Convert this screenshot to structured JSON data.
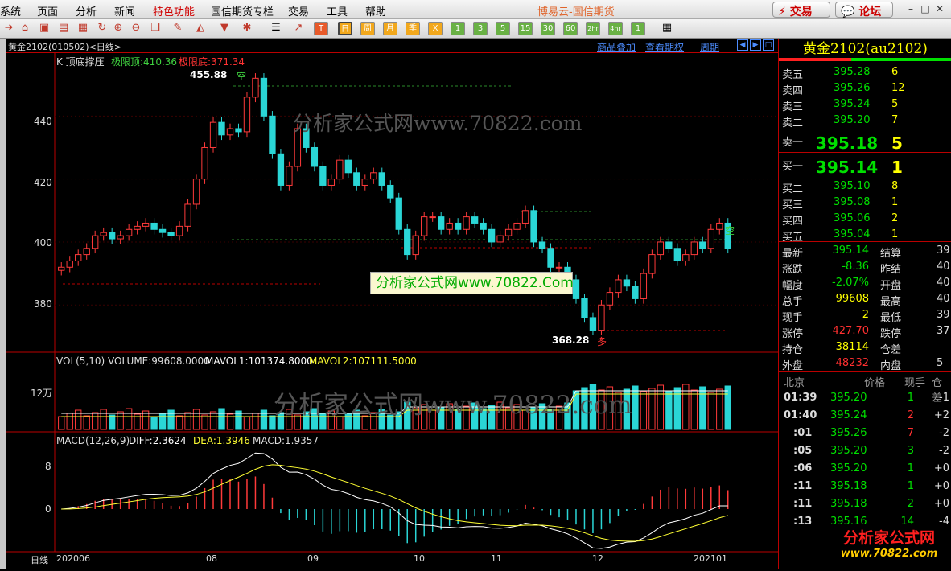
{
  "menu": {
    "items": [
      "系统",
      "页面",
      "分析",
      "新闻",
      "特色功能",
      "国信期货专栏",
      "交易",
      "工具",
      "帮助"
    ],
    "app_title": "博易云-国信期货",
    "trade_button": "交易",
    "forum_button": "论坛"
  },
  "toolbar": {
    "periods": [
      "日",
      "周",
      "月",
      "季",
      "X",
      "1",
      "3",
      "5",
      "15",
      "30",
      "60",
      "2hr",
      "4hr",
      "1"
    ]
  },
  "chart_header": {
    "code": "黄金2102(010502)<日线>",
    "links": [
      "商品叠加",
      "查看期权",
      "周期"
    ]
  },
  "kline": {
    "indicator": "K  顶底撑压",
    "top_label": "极限顶:410.36",
    "bottom_label": "极限底:371.34",
    "high_label": "455.88",
    "low_label": "368.28",
    "short_mark": "空",
    "long_mark": "多",
    "yticks": [
      "440",
      "420",
      "400",
      "380"
    ]
  },
  "vol": {
    "title": "VOL(5,10)",
    "volume": "VOLUME:99608.0000",
    "mavol1": "MAVOL1:101374.8000",
    "mavol2": "MAVOL2:107111.5000",
    "ytick": "12万"
  },
  "macd": {
    "title": "MACD(12,26,9)",
    "diff": "DIFF:2.3624",
    "dea": "DEA:1.3946",
    "macd": "MACD:1.9357",
    "yticks": [
      "8",
      "0"
    ]
  },
  "xaxis": {
    "period_label": "日线",
    "labels": [
      "202006",
      "08",
      "09",
      "10",
      "11",
      "12",
      "202101"
    ]
  },
  "watermarks": {
    "main": "分析家公式网www.70822.com",
    "vol": "分析家公式网www.70822.com",
    "box": "分析家公式网www.70822.Com",
    "logo_line1": "分析家公式网",
    "logo_line2": "www.70822.com"
  },
  "quote": {
    "title": "黄金2102(au2102)",
    "asks": [
      {
        "label": "卖五",
        "price": "395.28",
        "vol": "6"
      },
      {
        "label": "卖四",
        "price": "395.26",
        "vol": "12"
      },
      {
        "label": "卖三",
        "price": "395.24",
        "vol": "5"
      },
      {
        "label": "卖二",
        "price": "395.20",
        "vol": "7"
      },
      {
        "label": "卖一",
        "price": "395.18",
        "vol": "5"
      }
    ],
    "bids": [
      {
        "label": "买一",
        "price": "395.14",
        "vol": "1"
      },
      {
        "label": "买二",
        "price": "395.10",
        "vol": "8"
      },
      {
        "label": "买三",
        "price": "395.08",
        "vol": "1"
      },
      {
        "label": "买四",
        "price": "395.06",
        "vol": "2"
      },
      {
        "label": "买五",
        "price": "395.04",
        "vol": "1"
      }
    ],
    "stats": [
      {
        "l1": "最新",
        "v1": "395.14",
        "l2": "结算",
        "v2": "39"
      },
      {
        "l1": "涨跌",
        "v1": "-8.36",
        "l2": "昨结",
        "v2": "40"
      },
      {
        "l1": "幅度",
        "v1": "-2.07%",
        "l2": "开盘",
        "v2": "40"
      },
      {
        "l1": "总手",
        "v1": "99608",
        "l2": "最高",
        "v2": "40"
      },
      {
        "l1": "现手",
        "v1": "2",
        "l2": "最低",
        "v2": "39"
      },
      {
        "l1": "涨停",
        "v1": "427.70",
        "l2": "跌停",
        "v2": "37"
      },
      {
        "l1": "持仓",
        "v1": "38114",
        "l2": "仓差",
        "v2": ""
      },
      {
        "l1": "外盘",
        "v1": "48232",
        "l2": "内盘",
        "v2": "5"
      }
    ],
    "ticks_header": [
      "北京",
      "价格",
      "现手",
      "仓差"
    ],
    "ticks": [
      {
        "time": "01:39",
        "price": "395.20",
        "vol": "1",
        "chg": "-1"
      },
      {
        "time": "01:40",
        "price": "395.24",
        "vol": "2",
        "chg": "+2"
      },
      {
        "time": ":01",
        "price": "395.26",
        "vol": "7",
        "chg": "-2"
      },
      {
        "time": ":05",
        "price": "395.20",
        "vol": "3",
        "chg": "-2"
      },
      {
        "time": ":06",
        "price": "395.20",
        "vol": "1",
        "chg": "+0"
      },
      {
        "time": ":11",
        "price": "395.18",
        "vol": "1",
        "chg": "+0"
      },
      {
        "time": ":11",
        "price": "395.18",
        "vol": "2",
        "chg": "+0"
      },
      {
        "time": ":13",
        "price": "395.16",
        "vol": "14",
        "chg": "-4"
      }
    ]
  },
  "chart_data": {
    "type": "candlestick",
    "ylim": [
      365,
      460
    ],
    "series": [
      {
        "name": "K",
        "values": [
          392,
          394,
          396,
          398,
          402,
          403,
          401,
          402,
          404,
          405,
          406,
          404,
          403,
          402,
          405,
          412,
          420,
          430,
          438,
          434,
          436,
          435,
          446,
          452,
          440,
          428,
          418,
          424,
          436,
          430,
          424,
          418,
          420,
          426,
          422,
          418,
          420,
          422,
          418,
          414,
          404,
          396,
          402,
          408,
          408,
          404,
          406,
          404,
          408,
          406,
          404,
          400,
          402,
          404,
          406,
          410,
          400,
          398,
          392,
          392,
          388,
          382,
          376,
          372,
          380,
          384,
          388,
          386,
          382,
          390,
          396,
          400,
          398,
          394,
          396,
          400,
          398,
          404,
          406,
          398
        ]
      }
    ]
  }
}
